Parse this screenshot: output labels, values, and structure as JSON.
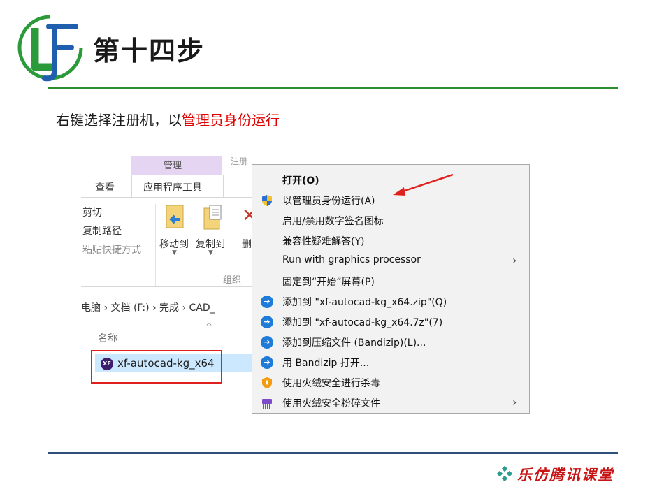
{
  "slide": {
    "title": "第十四步",
    "instruction_plain": "右键选择注册机，以",
    "instruction_highlight": "管理员身份运行",
    "brand": "乐仿腾讯课堂",
    "colors": {
      "accent_green": "#2f8b2f",
      "highlight_red": "#e00000",
      "rule_blue": "#2e4f7a"
    }
  },
  "explorer": {
    "manage_label": "管理",
    "partial_window_title": "注册",
    "tabs": {
      "view": "查看",
      "app_tools": "应用程序工具"
    },
    "clipboard": {
      "cut": "剪切",
      "copy_path": "复制路径",
      "paste_shortcut": "粘贴快捷方式"
    },
    "organize": {
      "move_to": "移动到",
      "copy_to": "复制到",
      "delete_partial": "删",
      "group_label": "组织"
    },
    "breadcrumb": "电脑 › 文档 (F:) › 完成 › CAD_",
    "column_name": "名称",
    "selected_file": {
      "name": "xf-autocad-kg_x64",
      "icon_text": "XF"
    }
  },
  "context_menu": {
    "items": [
      {
        "label": "打开(O)",
        "icon": "none",
        "bold": true
      },
      {
        "label": "以管理员身份运行(A)",
        "icon": "uac-shield-icon"
      },
      {
        "label": "启用/禁用数字签名图标",
        "icon": "none"
      },
      {
        "label": "兼容性疑难解答(Y)",
        "icon": "none"
      },
      {
        "label": "Run with graphics processor",
        "icon": "none",
        "submenu": true
      },
      {
        "label": "固定到“开始”屏幕(P)",
        "icon": "none"
      },
      {
        "label": "添加到 \"xf-autocad-kg_x64.zip\"(Q)",
        "icon": "bandizip-icon"
      },
      {
        "label": "添加到 \"xf-autocad-kg_x64.7z\"(7)",
        "icon": "bandizip-icon"
      },
      {
        "label": "添加到压缩文件 (Bandizip)(L)...",
        "icon": "bandizip-icon"
      },
      {
        "label": "用 Bandizip 打开...",
        "icon": "bandizip-icon"
      },
      {
        "label": "使用火绒安全进行杀毒",
        "icon": "huorong-shield-icon"
      },
      {
        "label": "使用火绒安全粉碎文件",
        "icon": "shredder-icon",
        "submenu": true
      }
    ]
  }
}
